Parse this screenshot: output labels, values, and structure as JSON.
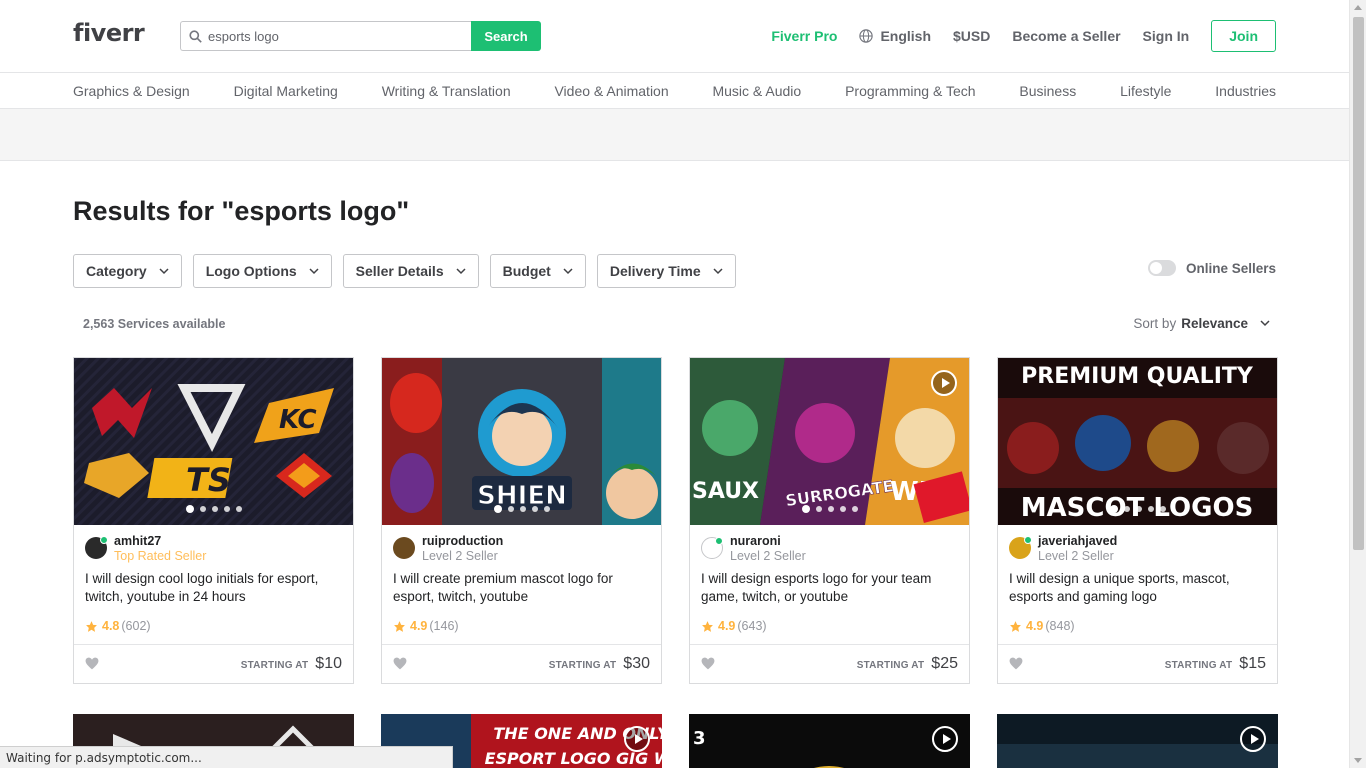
{
  "header": {
    "logo": "fiverr",
    "search_value": "esports logo",
    "search_button": "Search",
    "fiverr_pro": "Fiverr Pro",
    "language": "English",
    "currency": "$USD",
    "become_seller": "Become a Seller",
    "sign_in": "Sign In",
    "join": "Join"
  },
  "categories": [
    "Graphics & Design",
    "Digital Marketing",
    "Writing & Translation",
    "Video & Animation",
    "Music & Audio",
    "Programming & Tech",
    "Business",
    "Lifestyle",
    "Industries"
  ],
  "results_title": "Results for \"esports logo\"",
  "filters": [
    "Category",
    "Logo Options",
    "Seller Details",
    "Budget",
    "Delivery Time"
  ],
  "online_sellers": "Online Sellers",
  "services_available": "2,563 Services available",
  "sort_by_label": "Sort by",
  "sort_by_value": "Relevance",
  "starting_at": "STARTING AT",
  "gigs": [
    {
      "seller": "amhit27",
      "level": "Top Rated Seller",
      "title": "I will design cool logo initials for esport, twitch, youtube in 24 hours",
      "rating": "4.8",
      "reviews": "(602)",
      "price": "$10",
      "image_text": "TS"
    },
    {
      "seller": "ruiproduction",
      "level": "Level 2 Seller",
      "title": "I will create premium mascot logo for esport, twitch, youtube",
      "rating": "4.9",
      "reviews": "(146)",
      "price": "$30",
      "image_text": "SHIEN"
    },
    {
      "seller": "nuraroni",
      "level": "Level 2 Seller",
      "title": "I will design esports logo for your team game, twitch, or youtube",
      "rating": "4.9",
      "reviews": "(643)",
      "price": "$25",
      "image_text": "SURROGATE"
    },
    {
      "seller": "javeriahjaved",
      "level": "Level 2 Seller",
      "title": "I will design a unique sports, mascot, esports and gaming logo",
      "rating": "4.9",
      "reviews": "(848)",
      "price": "$15",
      "image_text": "PREMIUM QUALITY"
    }
  ],
  "row2_image_texts": [
    "",
    "THE ONE AND ONLY ESPORT LOGO GIG WI",
    "",
    ""
  ],
  "status_bar": "Waiting for p.adsymptotic.com...",
  "colors": {
    "brand_green": "#1dbf73",
    "star_yellow": "#ffb33e",
    "top_rated": "#ffbe5b"
  }
}
